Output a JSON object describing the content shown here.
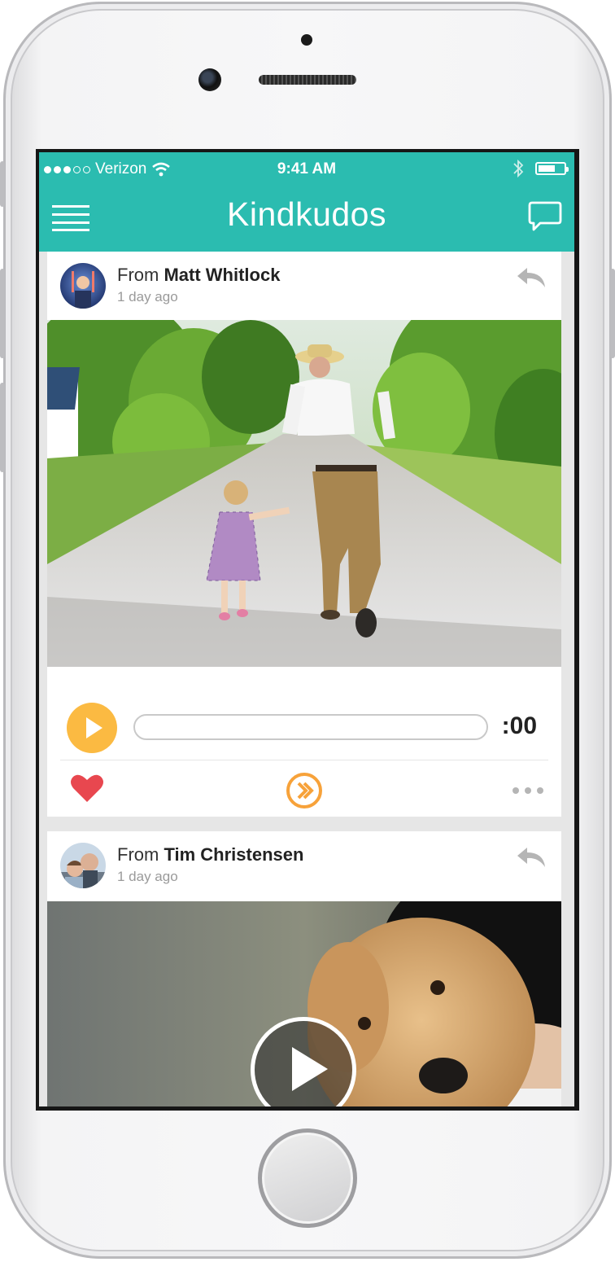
{
  "status_bar": {
    "carrier": "Verizon",
    "time": "9:41 AM",
    "signal_full": 3,
    "signal_empty": 2,
    "icons": [
      "wifi-icon",
      "bluetooth-icon",
      "battery-icon"
    ]
  },
  "nav": {
    "title": "Kindkudos",
    "left_icon": "hamburger-menu-icon",
    "right_icon": "chat-bubble-icon"
  },
  "posts": [
    {
      "from_prefix": "From",
      "sender": "Matt Whitlock",
      "time_ago": "1 day ago",
      "media": "photo",
      "audio_duration": ":00",
      "audio_progress": 0,
      "actions": [
        "heart-icon",
        "forward-icon",
        "more-icon"
      ]
    },
    {
      "from_prefix": "From",
      "sender": "Tim Christensen",
      "time_ago": "1 day ago",
      "media": "video"
    }
  ],
  "colors": {
    "teal": "#2bbcb0",
    "play_orange": "#fbba42",
    "heart_red": "#e8474f",
    "forward_orange": "#f7a23a"
  }
}
